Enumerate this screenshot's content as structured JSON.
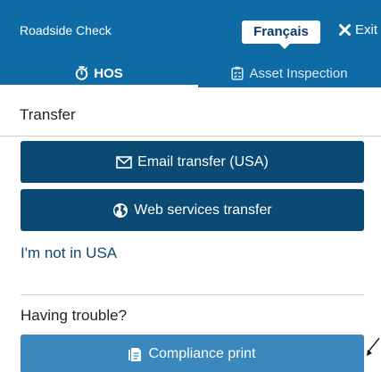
{
  "header": {
    "app_title": "Roadside Check",
    "language_button": "Français",
    "exit_label": "Exit",
    "accent_color": "#0f6ba5"
  },
  "tabs": [
    {
      "label": "HOS",
      "icon": "stopwatch-icon",
      "active": true
    },
    {
      "label": "Asset Inspection",
      "icon": "clipboard-checklist-icon",
      "active": false
    }
  ],
  "transfer": {
    "title": "Transfer",
    "email_button": "Email transfer (USA)",
    "email_icon": "envelope-icon",
    "web_button": "Web services transfer",
    "web_icon": "globe-icon",
    "not_usa_link": "I'm not in USA"
  },
  "trouble": {
    "title": "Having trouble?",
    "print_button": "Compliance print",
    "print_icon": "document-print-icon"
  },
  "colors": {
    "primary_button": "#0b4a73",
    "secondary_button": "#3a88bd",
    "link": "#0b4a73"
  }
}
